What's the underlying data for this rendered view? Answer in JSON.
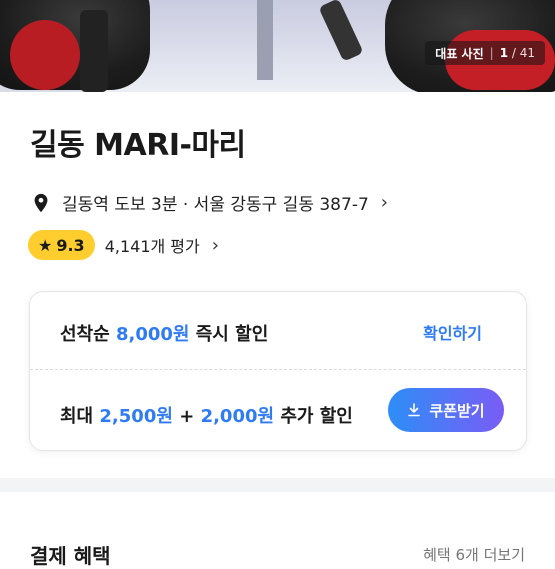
{
  "photo": {
    "label": "대표 사진",
    "current": "1",
    "total": "41"
  },
  "place": {
    "name": "길동 MARI-마리",
    "address": "길동역 도보 3분 · 서울 강동구 길동 387-7",
    "rating": "9.3",
    "reviews": "4,141개 평가"
  },
  "coupon": {
    "row1_prefix": "선착순",
    "row1_amount": "8,000원",
    "row1_suffix": "즉시 할인",
    "confirm_label": "확인하기",
    "row2_prefix": "최대",
    "row2_amount1": "2,500원",
    "row2_plus": "+",
    "row2_amount2": "2,000원",
    "row2_suffix": "추가 할인",
    "button_label": "쿠폰받기"
  },
  "benefits": {
    "title": "결제 혜택",
    "more": "혜택 6개 더보기"
  },
  "colors": {
    "accent": "#2f7bf5",
    "rating": "#ffce2e"
  }
}
